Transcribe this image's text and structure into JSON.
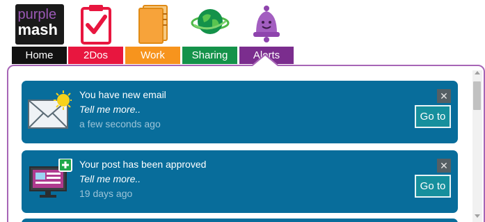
{
  "logo": {
    "line1": "purple",
    "line2": "mash"
  },
  "nav": [
    {
      "label": "Home",
      "color": "#111111",
      "icon": "purple-mash-logo"
    },
    {
      "label": "2Dos",
      "color": "#e8163f",
      "icon": "clipboard-check-icon"
    },
    {
      "label": "Work",
      "color": "#f7941d",
      "icon": "folder-icon"
    },
    {
      "label": "Sharing",
      "color": "#14924a",
      "icon": "globe-icon"
    },
    {
      "label": "Alerts",
      "color": "#7b2d8e",
      "icon": "bell-icon"
    }
  ],
  "alerts": [
    {
      "title": "You have new email",
      "more": "Tell me more..",
      "time": "a few seconds ago",
      "button": "Go to",
      "close": "✕",
      "icon": "envelope-icon"
    },
    {
      "title": "Your post has been approved",
      "more": "Tell me more..",
      "time": "19 days ago",
      "button": "Go to",
      "close": "✕",
      "icon": "monitor-post-icon"
    }
  ],
  "colors": {
    "panel_border": "#a765b6",
    "card_bg": "#086d9b",
    "goto_bg": "#168f9d"
  }
}
